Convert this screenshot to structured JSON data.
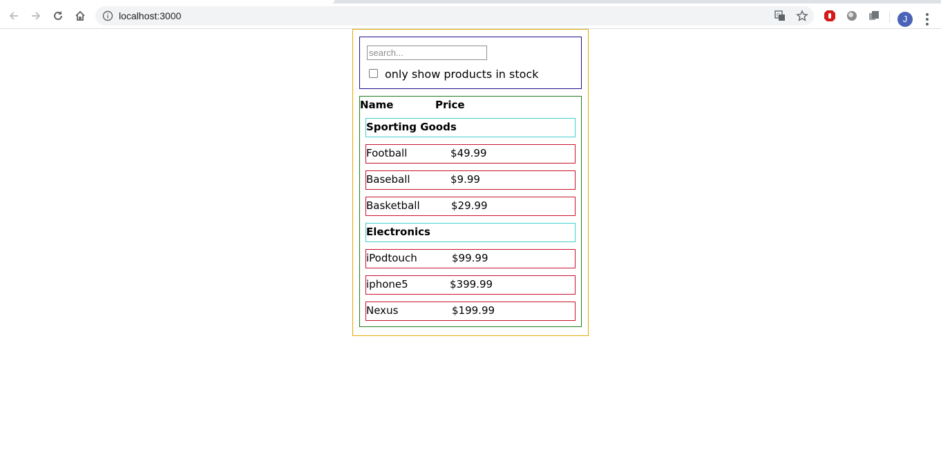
{
  "browser": {
    "url": "localhost:3000",
    "avatar_initial": "J",
    "icons": [
      "back-arrow-icon",
      "forward-arrow-icon",
      "reload-icon",
      "home-icon",
      "info-icon",
      "translate-icon",
      "star-icon",
      "adblock-icon",
      "extension-icon",
      "extension-icon",
      "menu-dots-icon"
    ]
  },
  "search": {
    "placeholder": "search...",
    "value": "",
    "in_stock_label": "only show products in stock",
    "in_stock_checked": false
  },
  "table": {
    "headers": {
      "name": "Name",
      "price": "Price"
    },
    "categories": [
      {
        "name": "Sporting Goods",
        "products": [
          {
            "name": "Football",
            "price": "$49.99"
          },
          {
            "name": "Baseball",
            "price": "$9.99"
          },
          {
            "name": "Basketball",
            "price": "$29.99"
          }
        ]
      },
      {
        "name": "Electronics",
        "products": [
          {
            "name": "iPodtouch",
            "price": "$99.99"
          },
          {
            "name": "iphone5",
            "price": "$399.99"
          },
          {
            "name": "Nexus",
            "price": "$199.99"
          }
        ]
      }
    ]
  },
  "colors": {
    "app_border": "#e0a800",
    "search_border": "#1a0a8c",
    "table_border": "#1b7d1b",
    "category_border": "#40d0d0",
    "product_border": "#c8102e"
  }
}
